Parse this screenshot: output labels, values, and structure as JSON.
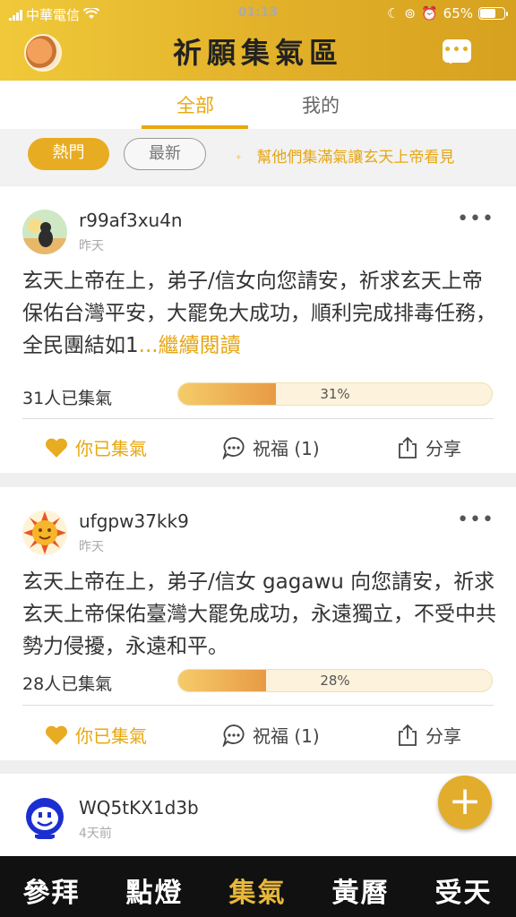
{
  "status_bar": {
    "carrier": "中華電信",
    "time": "01:13",
    "battery": "65%",
    "battery_level": 0.65
  },
  "header": {
    "title": "祈願集氣區",
    "chat_icon": "chat-bubble-icon"
  },
  "tabs": [
    {
      "label": "全部",
      "active": true
    },
    {
      "label": "我的",
      "active": false
    }
  ],
  "filters": {
    "hot_label": "熱門",
    "new_label": "最新",
    "slogan": "幫他們集滿氣讓玄天上帝看見"
  },
  "posts": [
    {
      "username": "r99af3xu4n",
      "time": "昨天",
      "content": "玄天上帝在上，弟子/信女向您請安，祈求玄天上帝保佑台灣平安，大罷免大成功，順利完成排毒任務，全民團結如1",
      "read_more": "...繼續閱讀",
      "gather_text": "31人已集氣",
      "progress": 31,
      "progress_label": "31%",
      "like_label": "你已集氣",
      "bless_label": "祝福 (1)",
      "share_label": "分享"
    },
    {
      "username": "ufgpw37kk9",
      "time": "昨天",
      "content": "玄天上帝在上，弟子/信女 gagawu 向您請安，祈求玄天上帝保佑臺灣大罷免成功，永遠獨立，不受中共勢力侵擾，永遠和平。",
      "gather_text": "28人已集氣",
      "progress": 28,
      "progress_label": "28%",
      "like_label": "你已集氣",
      "bless_label": "祝福 (1)",
      "share_label": "分享"
    },
    {
      "username": "WQ5tKX1d3b",
      "time": "4天前"
    }
  ],
  "fab_label": "+",
  "bottom_nav": [
    {
      "label": "參拜",
      "active": false
    },
    {
      "label": "點燈",
      "active": false
    },
    {
      "label": "集氣",
      "active": true
    },
    {
      "label": "黃曆",
      "active": false
    },
    {
      "label": "受天",
      "active": false
    }
  ],
  "colors": {
    "accent": "#e8a80f",
    "header_gradient_start": "#f0c93a",
    "header_gradient_end": "#d6a11f",
    "nav_background": "#111111"
  }
}
